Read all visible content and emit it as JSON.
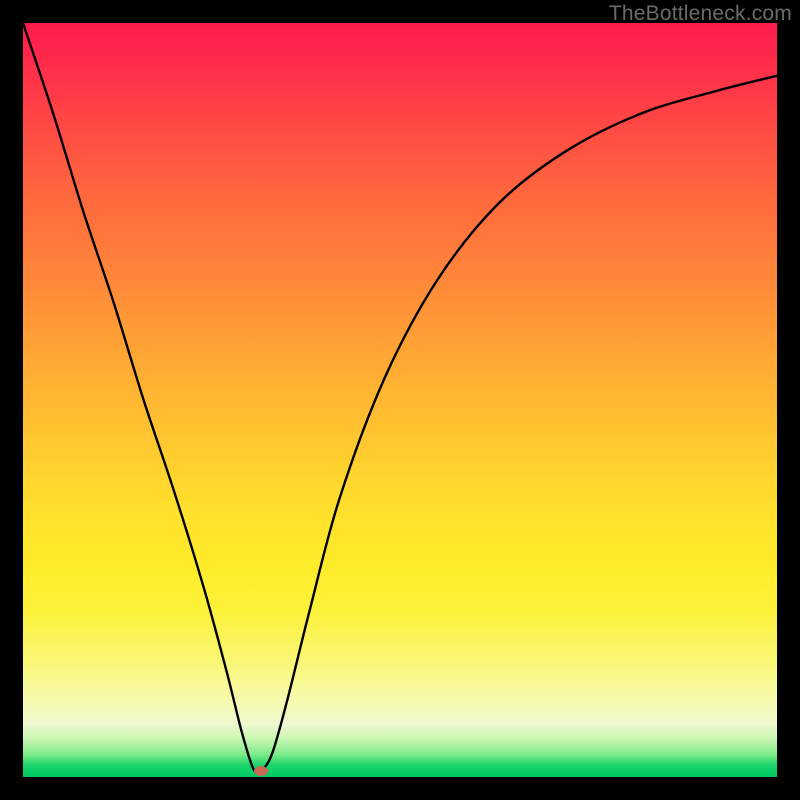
{
  "watermark": "TheBottleneck.com",
  "marker": {
    "x_pct": 0.315,
    "y_pct": 0.992
  },
  "chart_data": {
    "type": "line",
    "title": "",
    "xlabel": "",
    "ylabel": "",
    "xlim": [
      0,
      100
    ],
    "ylim": [
      0,
      100
    ],
    "series": [
      {
        "name": "bottleneck-curve",
        "x": [
          0,
          4,
          8,
          12,
          16,
          20,
          24,
          27,
          29,
          30.5,
          31.5,
          33,
          35,
          38,
          42,
          48,
          55,
          63,
          72,
          82,
          92,
          100
        ],
        "values": [
          100,
          88,
          75,
          63,
          50,
          38,
          25,
          14,
          6,
          1.2,
          0.8,
          3,
          10,
          22,
          37,
          53,
          66,
          76,
          83,
          88,
          91,
          93
        ]
      }
    ],
    "annotations": [
      {
        "type": "marker",
        "x": 31.5,
        "y": 0.8,
        "color": "#c96a55"
      }
    ],
    "background_gradient": {
      "direction": "top-to-bottom",
      "stops": [
        {
          "pct": 0,
          "color": "#ff1a4c"
        },
        {
          "pct": 24,
          "color": "#ff6b3c"
        },
        {
          "pct": 54,
          "color": "#ffc330"
        },
        {
          "pct": 78,
          "color": "#fdf23a"
        },
        {
          "pct": 93,
          "color": "#eef9d0"
        },
        {
          "pct": 100,
          "color": "#00c862"
        }
      ]
    }
  }
}
